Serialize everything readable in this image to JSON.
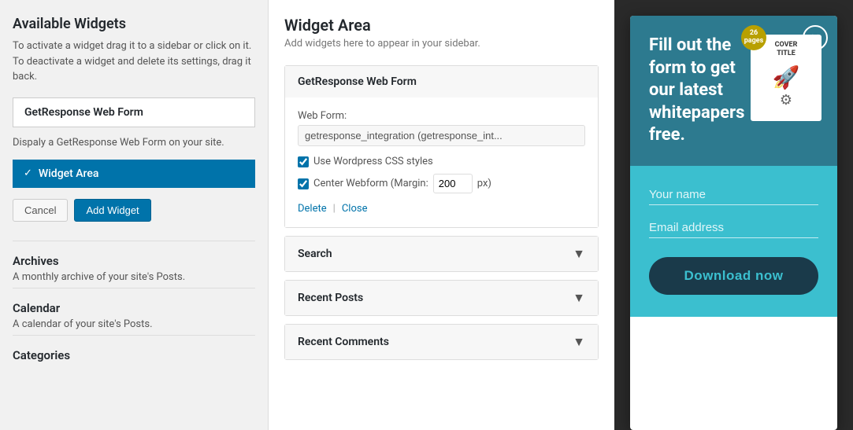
{
  "left_panel": {
    "title": "Available Widgets",
    "description": "To activate a widget drag it to a sidebar or click on it. To deactivate a widget and delete its settings, drag it back.",
    "widget_box_label": "GetResponse Web Form",
    "widget_description": "Dispaly a GetResponse Web Form on your site.",
    "selected_widget_label": "Widget Area",
    "btn_cancel": "Cancel",
    "btn_add_widget": "Add Widget",
    "sidebar_items": [
      {
        "name": "Archives",
        "desc": "A monthly archive of your site's Posts."
      },
      {
        "name": "Calendar",
        "desc": "A calendar of your site's Posts."
      },
      {
        "name": "Categories",
        "desc": ""
      }
    ]
  },
  "middle_panel": {
    "title": "Widget Area",
    "sub_description": "Add widgets here to appear in your sidebar.",
    "getresponse_section": {
      "header": "GetResponse Web Form",
      "web_form_label": "Web Form:",
      "web_form_value": "getresponse_integration (getresponse_int...",
      "checkbox1_label": "Use Wordpress CSS styles",
      "checkbox2_label": "Center Webform (Margin:",
      "margin_value": "200",
      "margin_unit": "px)",
      "link_delete": "Delete",
      "link_separator": "|",
      "link_close": "Close"
    },
    "sections": [
      {
        "name": "Search",
        "collapsed": true
      },
      {
        "name": "Recent Posts",
        "collapsed": true
      },
      {
        "name": "Recent Comments",
        "collapsed": true
      }
    ]
  },
  "popup": {
    "close_icon": "×",
    "headline": "Fill out the form to get our latest whitepapers free.",
    "cover": {
      "badge_number": "26",
      "badge_unit": "pages",
      "title_line1": "COVER",
      "title_line2": "TITLE"
    },
    "name_placeholder": "Your name",
    "email_placeholder": "Email address",
    "download_btn_label": "Download now"
  },
  "colors": {
    "blue": "#0073aa",
    "teal_dark": "#2d7a8f",
    "teal_light": "#3bbfcf",
    "navy": "#1a3a4a",
    "overlay_bg": "#2a2a2a"
  }
}
